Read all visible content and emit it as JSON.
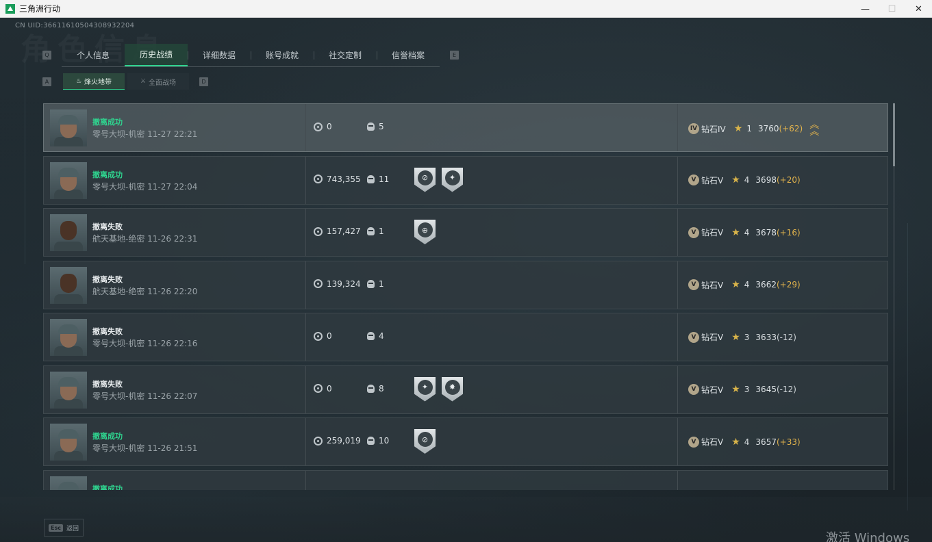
{
  "window": {
    "title": "三角洲行动",
    "controls": [
      "—",
      "☐",
      "✕"
    ]
  },
  "uid": "CN UID:36611610504308932204",
  "background_text": "角色信息",
  "tabs": {
    "left_key": "Q",
    "right_key": "E",
    "items": [
      {
        "label": "个人信息"
      },
      {
        "label": "历史战绩",
        "active": true
      },
      {
        "label": "详细数据"
      },
      {
        "label": "账号成就"
      },
      {
        "label": "社交定制"
      },
      {
        "label": "信誉档案"
      }
    ]
  },
  "subtabs": {
    "left_key": "A",
    "right_key": "D",
    "items": [
      {
        "label": "烽火地带",
        "icon": "flame-zone-icon",
        "active": true
      },
      {
        "label": "全面战场",
        "icon": "battlefield-icon"
      }
    ]
  },
  "records": [
    {
      "status": "撤离成功",
      "success": true,
      "map": "零号大坝-机密 11-27 22:21",
      "cash": "0",
      "kills": "5",
      "badges": [],
      "rank": "钻石IV",
      "rank_roman": "IV",
      "stars": "1",
      "score": "3760",
      "delta": "(+62)",
      "delta_positive": true,
      "promoted": true,
      "selected": true,
      "avatar": "helmet"
    },
    {
      "status": "撤离成功",
      "success": true,
      "map": "零号大坝-机密 11-27 22:04",
      "cash": "743,355",
      "kills": "11",
      "badges": [
        "⊘",
        "✦"
      ],
      "rank": "钻石V",
      "rank_roman": "V",
      "stars": "4",
      "score": "3698",
      "delta": "(+20)",
      "delta_positive": true,
      "avatar": "helmet"
    },
    {
      "status": "撤离失败",
      "success": false,
      "map": "航天基地-绝密 11-26 22:31",
      "cash": "157,427",
      "kills": "1",
      "badges": [
        "⊕"
      ],
      "rank": "钻石V",
      "rank_roman": "V",
      "stars": "4",
      "score": "3678",
      "delta": "(+16)",
      "delta_positive": true,
      "avatar": "bald"
    },
    {
      "status": "撤离失败",
      "success": false,
      "map": "航天基地-绝密 11-26 22:20",
      "cash": "139,324",
      "kills": "1",
      "badges": [],
      "rank": "钻石V",
      "rank_roman": "V",
      "stars": "4",
      "score": "3662",
      "delta": "(+29)",
      "delta_positive": true,
      "avatar": "bald"
    },
    {
      "status": "撤离失败",
      "success": false,
      "map": "零号大坝-机密 11-26 22:16",
      "cash": "0",
      "kills": "4",
      "badges": [],
      "rank": "钻石V",
      "rank_roman": "V",
      "stars": "3",
      "score": "3633",
      "delta": "(-12)",
      "delta_positive": false,
      "avatar": "helmet"
    },
    {
      "status": "撤离失败",
      "success": false,
      "map": "零号大坝-机密 11-26 22:07",
      "cash": "0",
      "kills": "8",
      "badges": [
        "✦",
        "✸"
      ],
      "rank": "钻石V",
      "rank_roman": "V",
      "stars": "3",
      "score": "3645",
      "delta": "(-12)",
      "delta_positive": false,
      "avatar": "helmet"
    },
    {
      "status": "撤离成功",
      "success": true,
      "map": "零号大坝-机密 11-26 21:51",
      "cash": "259,019",
      "kills": "10",
      "badges": [
        "⊘"
      ],
      "rank": "钻石V",
      "rank_roman": "V",
      "stars": "4",
      "score": "3657",
      "delta": "(+33)",
      "delta_positive": true,
      "avatar": "helmet"
    },
    {
      "status": "撤离成功",
      "success": true,
      "map": "",
      "cash": "",
      "kills": "",
      "badges": [],
      "rank": "",
      "rank_roman": "",
      "stars": "",
      "score": "",
      "delta": "",
      "delta_positive": true,
      "avatar": "helmet"
    }
  ],
  "footer": {
    "esc_key": "Esc",
    "back_label": "返回"
  },
  "os_watermark": "激活 Windows",
  "colors": {
    "accent_green": "#2fd48f",
    "delta_gold": "#e2b34c",
    "star_gold": "#d9b44a"
  }
}
